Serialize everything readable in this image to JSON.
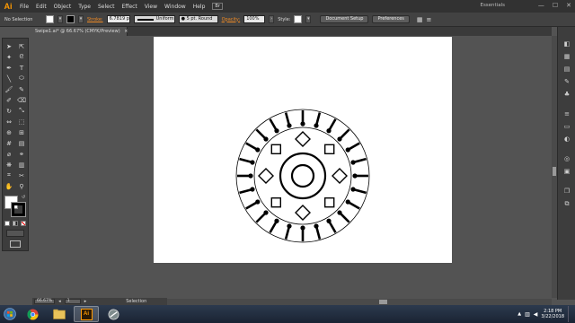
{
  "app": {
    "logo": "Ai",
    "workspace": "Essentials"
  },
  "menu": [
    "File",
    "Edit",
    "Object",
    "Type",
    "Select",
    "Effect",
    "View",
    "Window",
    "Help"
  ],
  "window_controls": [
    "—",
    "☐",
    "✕"
  ],
  "control_bar": {
    "selection_label": "No Selection",
    "stroke_label": "Stroke:",
    "stroke_value": "6.7819 p",
    "profile": "Uniform",
    "brush": "5 pt. Round",
    "opacity_label": "Opacity:",
    "opacity_value": "100%",
    "style_label": "Style:",
    "doc_setup": "Document Setup",
    "preferences": "Preferences"
  },
  "document_tab": {
    "title": "Swipe1.ai* @ 66.67% (CMYK/Preview)",
    "close": "×"
  },
  "status_bar": {
    "zoom": "66.67%",
    "page": "1",
    "mode": "Selection"
  },
  "taskbar": {
    "ai_label": "Ai",
    "time": "2:18 PM",
    "date": "3/22/2018"
  },
  "colors": {
    "accent": "#f08a24",
    "menubar": "#323232",
    "workspace_bg": "#535353",
    "artboard": "#ffffff",
    "ai_brand": "#ff9a00"
  }
}
